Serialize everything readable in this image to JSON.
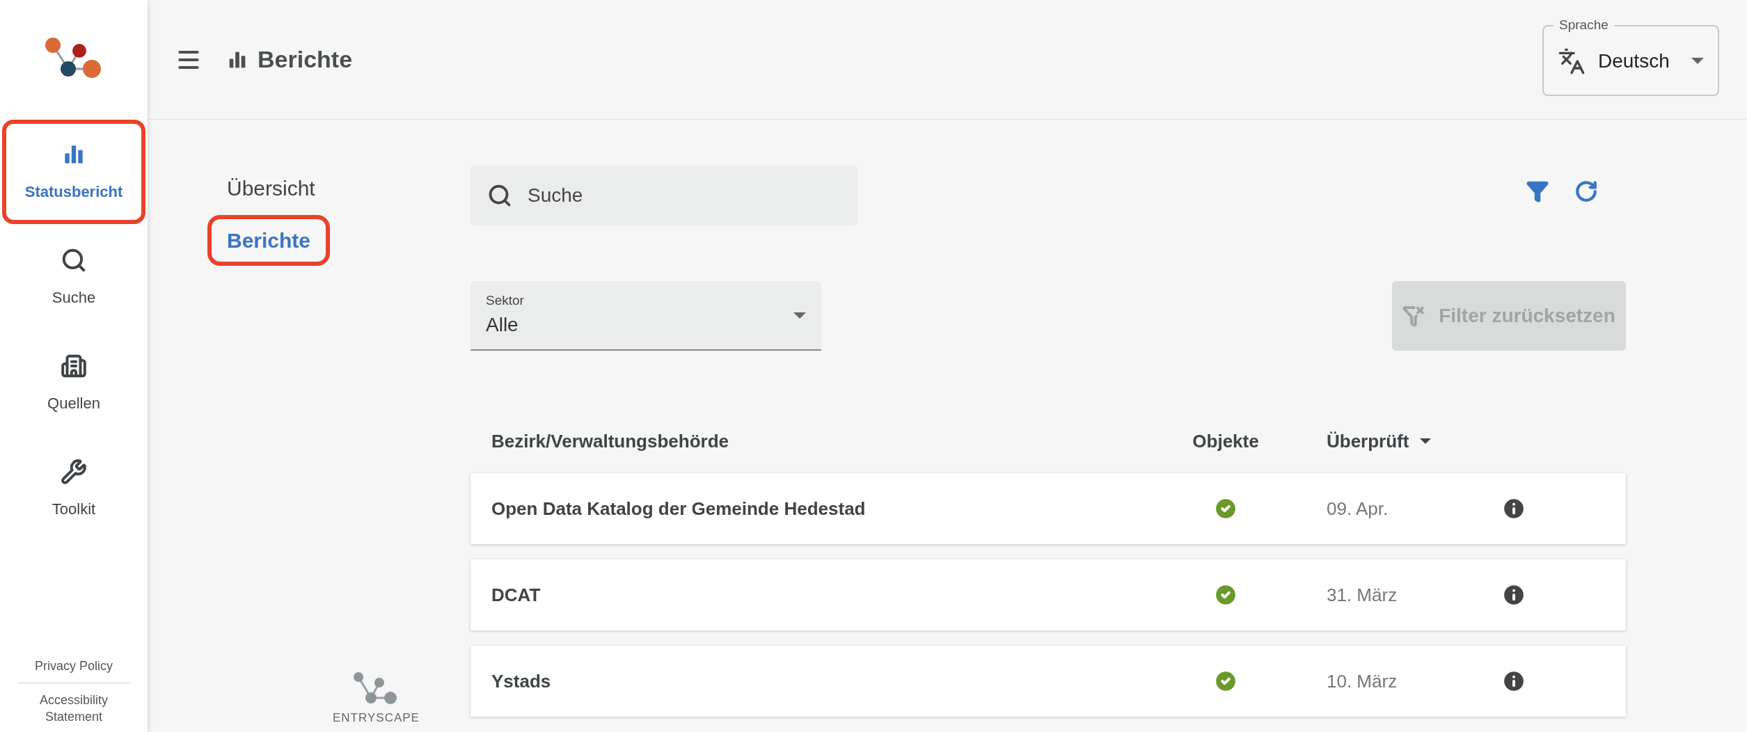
{
  "sidebar": {
    "items": [
      {
        "label": "Statusbericht",
        "kind": "chart",
        "selected": true,
        "highlighted": true
      },
      {
        "label": "Suche",
        "kind": "search",
        "selected": false,
        "highlighted": false
      },
      {
        "label": "Quellen",
        "kind": "building",
        "selected": false,
        "highlighted": false
      },
      {
        "label": "Toolkit",
        "kind": "wrench",
        "selected": false,
        "highlighted": false
      }
    ],
    "footer_links": [
      "Privacy Policy",
      "Accessibility Statement"
    ]
  },
  "header": {
    "title": "Berichte"
  },
  "language": {
    "label": "Sprache",
    "value": "Deutsch"
  },
  "subnav": [
    {
      "label": "Übersicht",
      "selected": false,
      "highlighted": false
    },
    {
      "label": "Berichte",
      "selected": true,
      "highlighted": true
    }
  ],
  "search": {
    "placeholder": "Suche"
  },
  "sector_select": {
    "label": "Sektor",
    "value": "Alle"
  },
  "reset_button": {
    "label": "Filter zurücksetzen",
    "disabled": true
  },
  "table": {
    "columns": [
      {
        "label": "Bezirk/Verwaltungsbehörde",
        "sorted": false
      },
      {
        "label": "Objekte",
        "sorted": false
      },
      {
        "label": "Überprüft",
        "sorted": true
      }
    ],
    "rows": [
      {
        "name": "Open Data Katalog der Gemeinde Hedestad",
        "objects_ok": true,
        "checked": "09. Apr."
      },
      {
        "name": "DCAT",
        "objects_ok": true,
        "checked": "31. März"
      },
      {
        "name": "Ystads",
        "objects_ok": true,
        "checked": "10. März"
      }
    ]
  },
  "brand": "ENTRYSCAPE"
}
